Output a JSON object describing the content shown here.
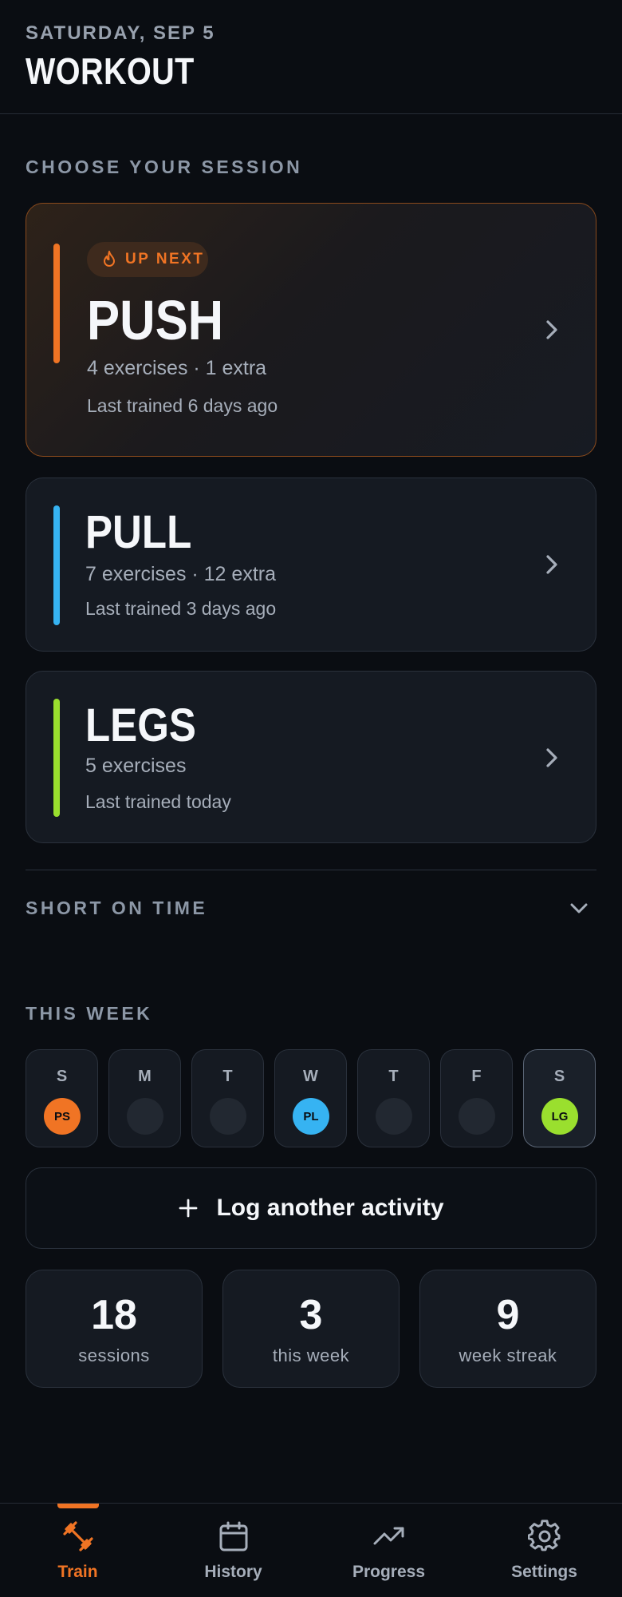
{
  "header": {
    "date": "SATURDAY, SEP 5",
    "title": "WORKOUT"
  },
  "sessions": {
    "label": "CHOOSE YOUR SESSION",
    "items": [
      {
        "badge": "UP NEXT",
        "name": "PUSH",
        "details": "4 exercises · 1 extra",
        "last": "Last trained 6 days ago",
        "color": "#f07424"
      },
      {
        "name": "PULL",
        "details": "7 exercises · 12 extra",
        "last": "Last trained 3 days ago",
        "color": "#36b3f2"
      },
      {
        "name": "LEGS",
        "details": "5 exercises",
        "last": "Last trained today",
        "color": "#9adf2e"
      }
    ]
  },
  "short_on_time": {
    "label": "SHORT ON TIME"
  },
  "week": {
    "label": "THIS WEEK",
    "days": [
      {
        "letter": "S",
        "session": "PS",
        "color": "#f07424"
      },
      {
        "letter": "M",
        "session": ""
      },
      {
        "letter": "T",
        "session": ""
      },
      {
        "letter": "W",
        "session": "PL",
        "color": "#36b3f2"
      },
      {
        "letter": "T",
        "session": ""
      },
      {
        "letter": "F",
        "session": ""
      },
      {
        "letter": "S",
        "session": "LG",
        "color": "#9adf2e",
        "today": true
      }
    ]
  },
  "log_button": {
    "label": "Log another activity"
  },
  "stats": [
    {
      "value": "18",
      "label": "sessions"
    },
    {
      "value": "3",
      "label": "this week"
    },
    {
      "value": "9",
      "label": "week streak"
    }
  ],
  "tabs": [
    {
      "label": "Train",
      "icon": "dumbbell-icon",
      "active": true
    },
    {
      "label": "History",
      "icon": "calendar-icon"
    },
    {
      "label": "Progress",
      "icon": "trend-up-icon"
    },
    {
      "label": "Settings",
      "icon": "gear-icon"
    }
  ],
  "colors": {
    "accent": "#f07424",
    "background": "#0a0d12",
    "card": "#151a22"
  }
}
